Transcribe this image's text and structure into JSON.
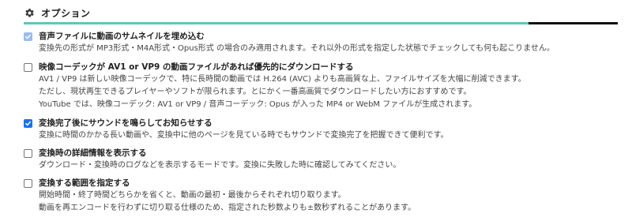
{
  "section": {
    "title": "オプション",
    "icon": "gear-icon"
  },
  "colors": {
    "accent": "#5fc7b5",
    "checkbox_checked": "#1a73e8"
  },
  "options": [
    {
      "checked": true,
      "label": "音声ファイルに動画のサムネイルを埋め込む",
      "desc": [
        "変換先の形式が MP3形式・M4A形式・Opus形式 の場合のみ適用されます。それ以外の形式を指定した状態でチェックしても何も起こりません。"
      ]
    },
    {
      "checked": false,
      "label": "映像コーデックが AV1 or VP9 の動画ファイルがあれば優先的にダウンロードする",
      "desc": [
        "AV1 / VP9 は新しい映像コーデックで、特に長時間の動画では H.264 (AVC) よりも高画質な上、ファイルサイズを大幅に削減できます。",
        "ただし、現状再生できるプレイヤーやソフトが限られます。とにかく一番高画質でダウンロードしたい方におすすめです。",
        "YouTube では、映像コーデック: AV1 or VP9 / 音声コーデック: Opus が入った MP4 or WebM ファイルが生成されます。"
      ]
    },
    {
      "checked": true,
      "label": "変換完了後にサウンドを鳴らしてお知らせする",
      "desc": [
        "変換に時間のかかる長い動画や、変換中に他のページを見ている時でもサウンドで変換完了を把握できて便利です。"
      ]
    },
    {
      "checked": false,
      "label": "変換時の詳細情報を表示する",
      "desc": [
        "ダウンロード・変換時のログなどを表示するモードです。変換に失敗した時に確認してみてください。"
      ]
    },
    {
      "checked": false,
      "label": "変換する範囲を指定する",
      "desc": [
        "開始時間・終了時間どちらかを省くと、動画の最初・最後からそれぞれ切り取ります。",
        "動画を再エンコードを行わずに切り取る仕様のため、指定された秒数よりも±数秒ずれることがあります。"
      ]
    }
  ]
}
